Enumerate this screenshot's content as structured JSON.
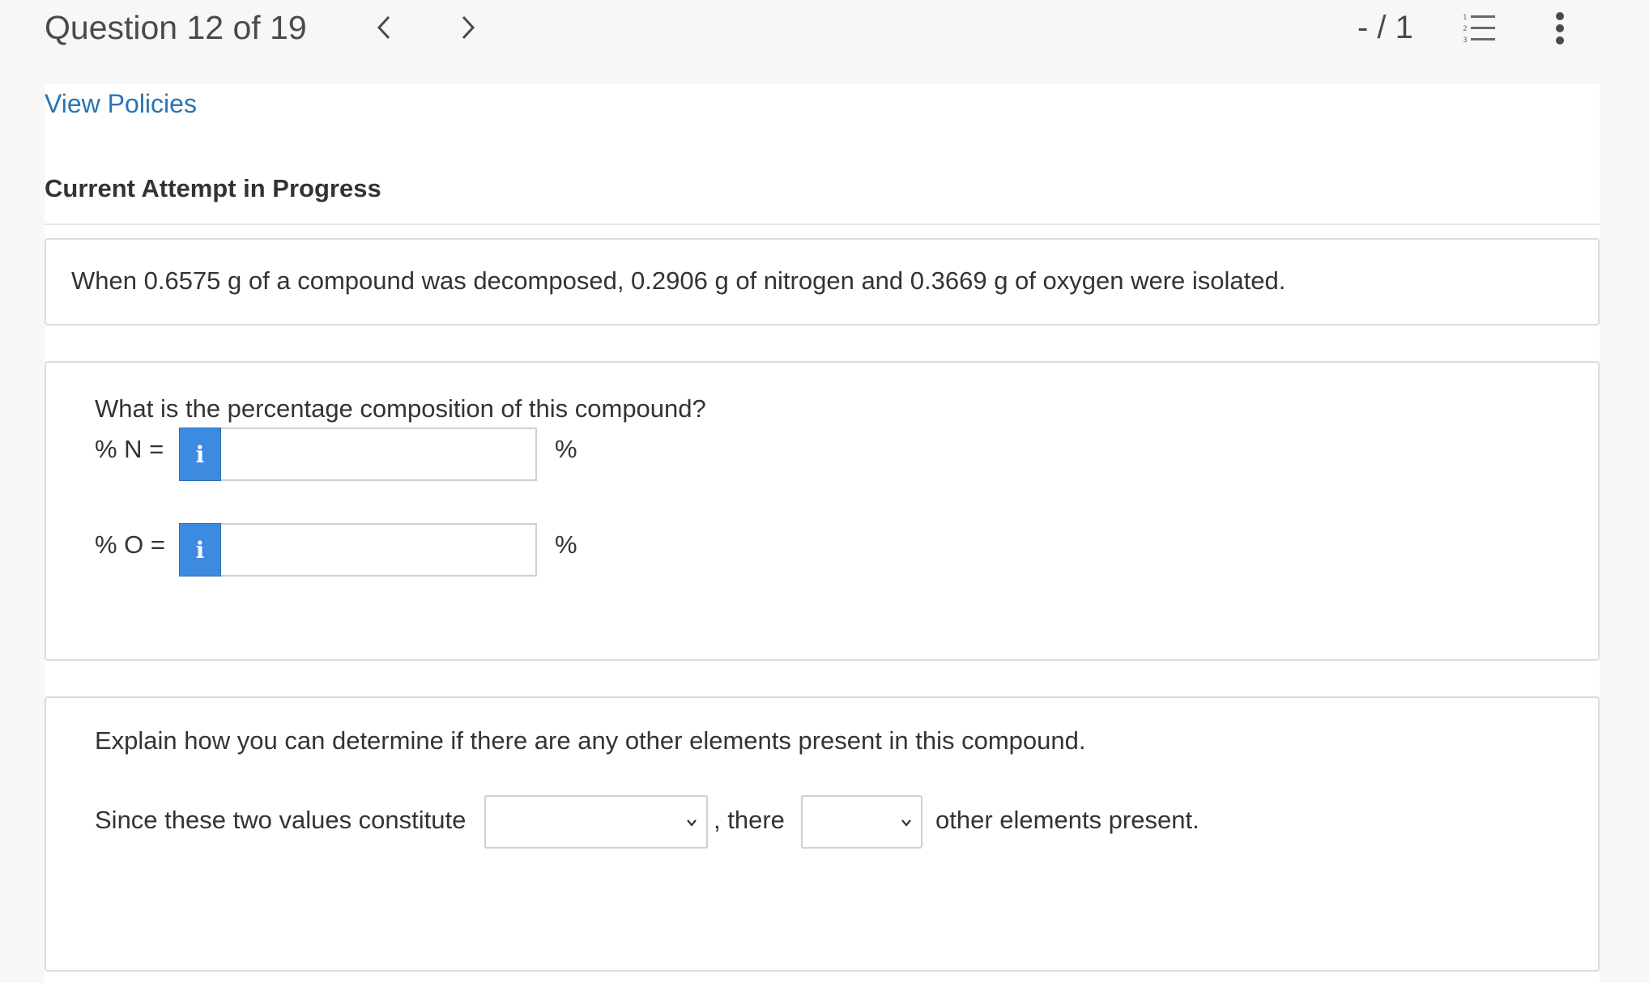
{
  "header": {
    "question_title": "Question 12 of 19",
    "score": "- / 1",
    "prev_icon": "chevron-left-icon",
    "next_icon": "chevron-right-icon",
    "list_icon": "numbered-list-icon",
    "more_icon": "vertical-ellipsis-icon"
  },
  "links": {
    "view_policies": "View Policies"
  },
  "status": {
    "attempt": "Current Attempt in Progress"
  },
  "question": {
    "stem": "When 0.6575 g of a compound was decomposed, 0.2906 g of nitrogen and 0.3669 g of oxygen were isolated."
  },
  "part1": {
    "prompt": "What is the percentage composition of this compound?",
    "rows": [
      {
        "label": "% N =",
        "info": "i",
        "value": "",
        "unit": "%"
      },
      {
        "label": "% O =",
        "info": "i",
        "value": "",
        "unit": "%"
      }
    ]
  },
  "part2": {
    "prompt": "Explain how you can determine if there are any other elements present in this compound.",
    "sentence_start": "Since these two values constitute",
    "dropdown1_value": "",
    "sentence_mid": ", there",
    "dropdown2_value": "",
    "sentence_end": "other elements present."
  },
  "colors": {
    "accent_blue": "#3d8be0",
    "link_blue": "#2a74b5"
  }
}
